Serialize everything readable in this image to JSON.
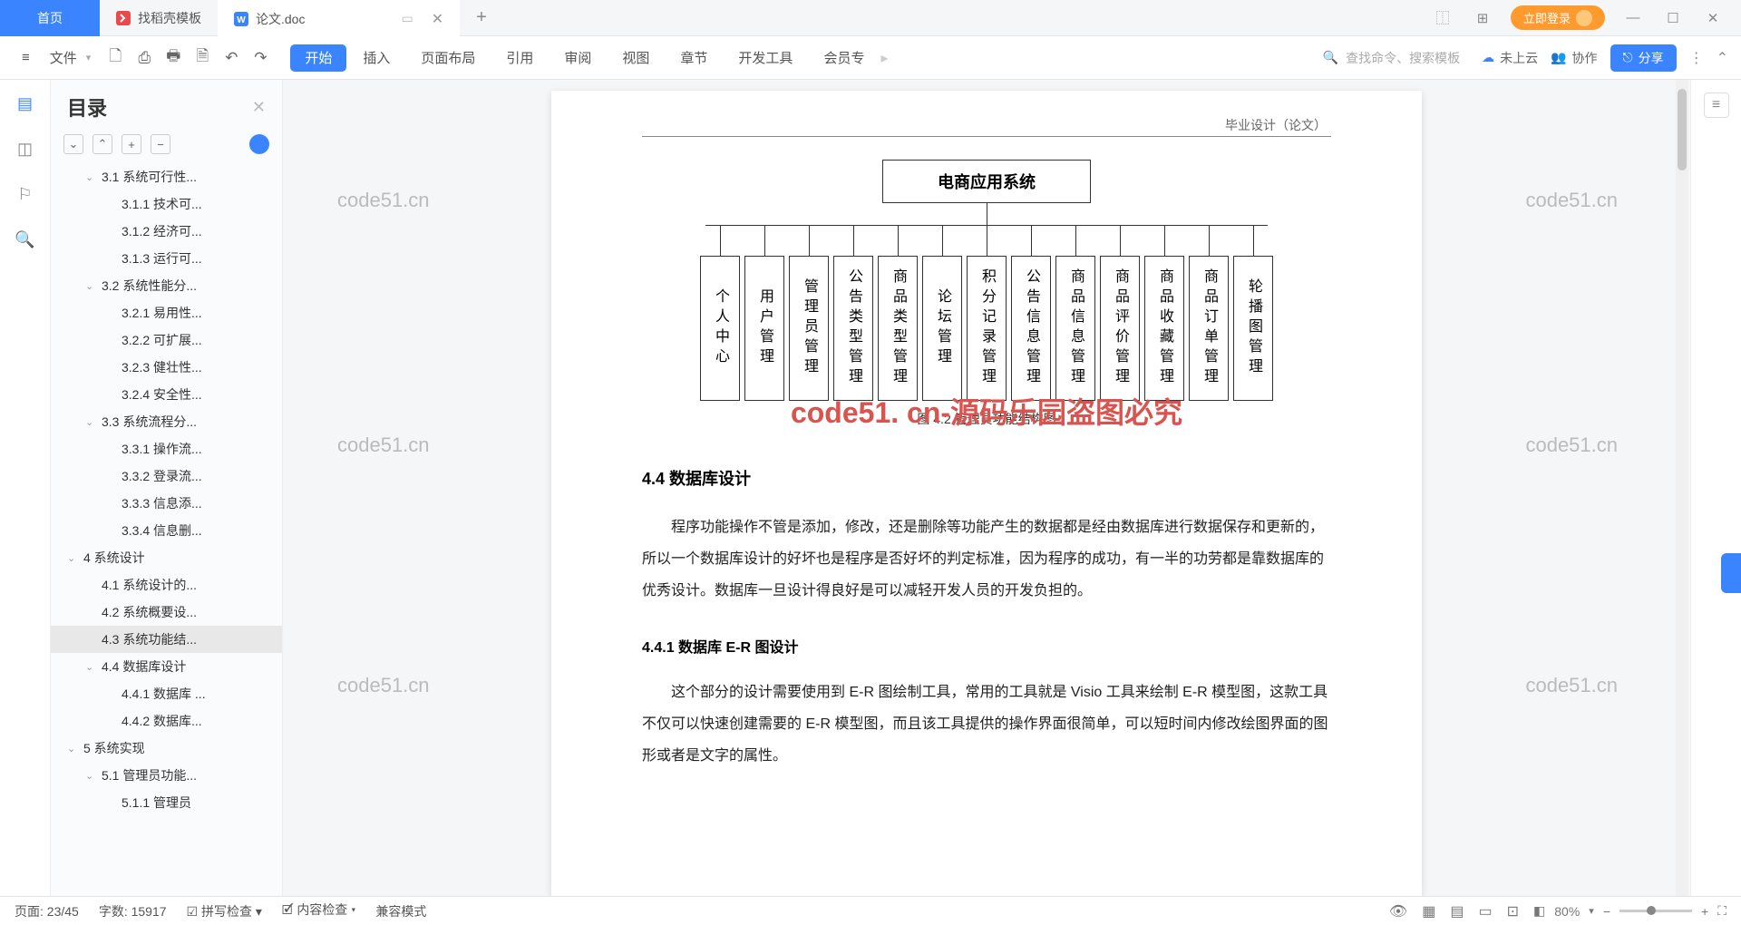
{
  "tabs": {
    "home": "首页",
    "t1": "找稻壳模板",
    "t2": "论文.doc"
  },
  "login": "立即登录",
  "file": "文件",
  "menus": {
    "start": "开始",
    "insert": "插入",
    "layout": "页面布局",
    "ref": "引用",
    "review": "审阅",
    "view": "视图",
    "chapter": "章节",
    "dev": "开发工具",
    "member": "会员专"
  },
  "search": "查找命令、搜索模板",
  "cloud": "未上云",
  "collab": "协作",
  "share": "分享",
  "outline": {
    "title": "目录",
    "items": [
      {
        "l": 2,
        "t": "3.1 系统可行性...",
        "c": 1
      },
      {
        "l": 3,
        "t": "3.1.1 技术可..."
      },
      {
        "l": 3,
        "t": "3.1.2 经济可..."
      },
      {
        "l": 3,
        "t": "3.1.3 运行可..."
      },
      {
        "l": 2,
        "t": "3.2 系统性能分...",
        "c": 1
      },
      {
        "l": 3,
        "t": "3.2.1 易用性..."
      },
      {
        "l": 3,
        "t": "3.2.2 可扩展..."
      },
      {
        "l": 3,
        "t": "3.2.3 健壮性..."
      },
      {
        "l": 3,
        "t": "3.2.4 安全性..."
      },
      {
        "l": 2,
        "t": "3.3 系统流程分...",
        "c": 1
      },
      {
        "l": 3,
        "t": "3.3.1 操作流..."
      },
      {
        "l": 3,
        "t": "3.3.2 登录流..."
      },
      {
        "l": 3,
        "t": "3.3.3 信息添..."
      },
      {
        "l": 3,
        "t": "3.3.4 信息删..."
      },
      {
        "l": 1,
        "t": "4 系统设计",
        "c": 1
      },
      {
        "l": 2,
        "t": "4.1 系统设计的..."
      },
      {
        "l": 2,
        "t": "4.2 系统概要设..."
      },
      {
        "l": 2,
        "t": "4.3 系统功能结...",
        "sel": 1
      },
      {
        "l": 2,
        "t": "4.4 数据库设计",
        "c": 1
      },
      {
        "l": 3,
        "t": "4.4.1 数据库 ..."
      },
      {
        "l": 3,
        "t": "4.4.2 数据库..."
      },
      {
        "l": 1,
        "t": "5 系统实现",
        "c": 1
      },
      {
        "l": 2,
        "t": "5.1 管理员功能...",
        "c": 1
      },
      {
        "l": 3,
        "t": "5.1.1 管理员"
      }
    ]
  },
  "doc": {
    "crumb": "毕业设计（论文）",
    "dia_top": "电商应用系统",
    "dia_boxes": [
      "个人中心",
      "用户管理",
      "管理员管理",
      "公告类型管理",
      "商品类型管理",
      "论坛管理",
      "积分记录管理",
      "公告信息管理",
      "商品信息管理",
      "商品评价管理",
      "商品收藏管理",
      "商品订单管理",
      "轮播图管理"
    ],
    "dia_caption": "图 4.2 管理员功能结构图",
    "watermark": "code51. cn-源码乐园盗图必究",
    "wm_sm": "code51.cn",
    "sec44": "4.4  数据库设计",
    "p1": "程序功能操作不管是添加，修改，还是删除等功能产生的数据都是经由数据库进行数据保存和更新的，所以一个数据库设计的好坏也是程序是否好坏的判定标准，因为程序的成功，有一半的功劳都是靠数据库的优秀设计。数据库一旦设计得良好是可以减轻开发人员的开发负担的。",
    "sec441": "4.4.1 数据库 E-R 图设计",
    "p2": "这个部分的设计需要使用到 E-R 图绘制工具，常用的工具就是 Visio 工具来绘制 E-R 模型图，这款工具不仅可以快速创建需要的 E-R 模型图，而且该工具提供的操作界面很简单，可以短时间内修改绘图界面的图形或者是文字的属性。"
  },
  "status": {
    "page": "页面: 23/45",
    "words": "字数: 15917",
    "spell": "拼写检查",
    "content": "内容检查",
    "compat": "兼容模式",
    "zoom": "80%"
  }
}
